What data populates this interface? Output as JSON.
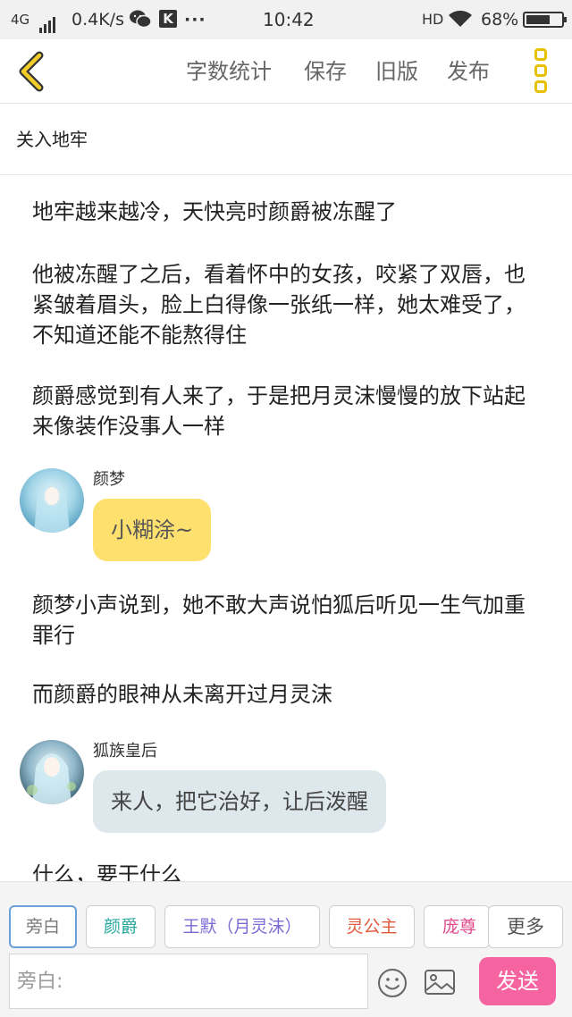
{
  "status_bar": {
    "network": "4G",
    "speed": "0.4K/s",
    "k_badge": "K",
    "dots": "···",
    "time": "10:42",
    "hd": "HD",
    "battery": "68%",
    "battery_level": 0.68
  },
  "toolbar": {
    "word_count": "字数统计",
    "save": "保存",
    "old_version": "旧版",
    "publish": "发布"
  },
  "chapter": {
    "title": "关入地牢"
  },
  "content": {
    "paragraphs": [
      "地牢越来越冷，天快亮时颜爵被冻醒了",
      "他被冻醒了之后，看着怀中的女孩，咬紧了双唇，也紧皱着眉头，脸上白得像一张纸一样，她太难受了，不知道还能不能熬得住",
      "颜爵感觉到有人来了，于是把月灵沫慢慢的放下站起来像装作没事人一样",
      "颜梦小声说到，她不敢大声说怕狐后听见一生气加重罪行",
      "而颜爵的眼神从未离开过月灵沫",
      "什么，要干什么"
    ],
    "dialogues": [
      {
        "speaker": "颜梦",
        "text": "小糊涂~",
        "color": "#fde06d"
      },
      {
        "speaker": "狐族皇后",
        "text": "来人，把它治好，让后泼醒",
        "color": "#dde7ec"
      }
    ]
  },
  "roles": [
    {
      "label": "旁白",
      "color": "#777777"
    },
    {
      "label": "颜爵",
      "color": "#29a9a0"
    },
    {
      "label": "王默（月灵沫）",
      "color": "#7d6ad6"
    },
    {
      "label": "灵公主",
      "color": "#e05a3c"
    },
    {
      "label": "庞尊",
      "color": "#e04a8e"
    }
  ],
  "more_label": "更多",
  "input": {
    "placeholder": "旁白:"
  },
  "send_label": "发送"
}
